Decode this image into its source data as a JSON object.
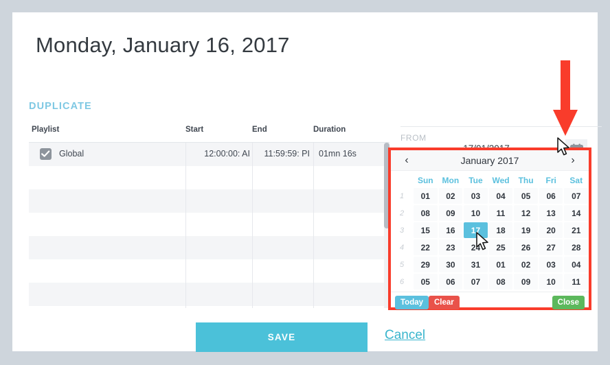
{
  "page": {
    "title": "Monday, January 16, 2017",
    "section_heading": "DUPLICATE",
    "background_color": "#ced5dc",
    "accent_color": "#4bc1d9"
  },
  "table": {
    "columns": [
      "Playlist",
      "Start",
      "End",
      "Duration"
    ],
    "rows": [
      {
        "checked": true,
        "playlist": "Global",
        "start": "12:00:00: AI",
        "end": "11:59:59: PI",
        "duration": "01mn 16s"
      }
    ],
    "empty_row_count": 7
  },
  "actions": {
    "save_label": "SAVE",
    "cancel_label": "Cancel"
  },
  "from_field": {
    "label": "FROM",
    "value": "17/01/2017",
    "icon": "calendar-icon"
  },
  "datepicker": {
    "title": "January 2017",
    "prev_label": "‹",
    "next_label": "›",
    "day_names": [
      "Sun",
      "Mon",
      "Tue",
      "Wed",
      "Thu",
      "Fri",
      "Sat"
    ],
    "week_numbers": [
      "1",
      "2",
      "3",
      "4",
      "5",
      "6"
    ],
    "weeks": [
      [
        "01",
        "02",
        "03",
        "04",
        "05",
        "06",
        "07"
      ],
      [
        "08",
        "09",
        "10",
        "11",
        "12",
        "13",
        "14"
      ],
      [
        "15",
        "16",
        "17",
        "18",
        "19",
        "20",
        "21"
      ],
      [
        "22",
        "23",
        "24",
        "25",
        "26",
        "27",
        "28"
      ],
      [
        "29",
        "30",
        "31",
        "01",
        "02",
        "03",
        "04"
      ],
      [
        "05",
        "06",
        "07",
        "08",
        "09",
        "10",
        "11"
      ]
    ],
    "selected_day": "17",
    "selected_week_index": 2,
    "selected_day_index": 2,
    "buttons": {
      "today": "Today",
      "clear": "Clear",
      "close": "Close"
    },
    "colors": {
      "selected": "#5bc0de",
      "today": "#5bc0de",
      "clear": "#e9524a",
      "close": "#5cb85c",
      "annotation_border": "#f93c2b"
    }
  },
  "annotation": {
    "arrow": "red-down-arrow",
    "arrow_color": "#f93c2b"
  }
}
